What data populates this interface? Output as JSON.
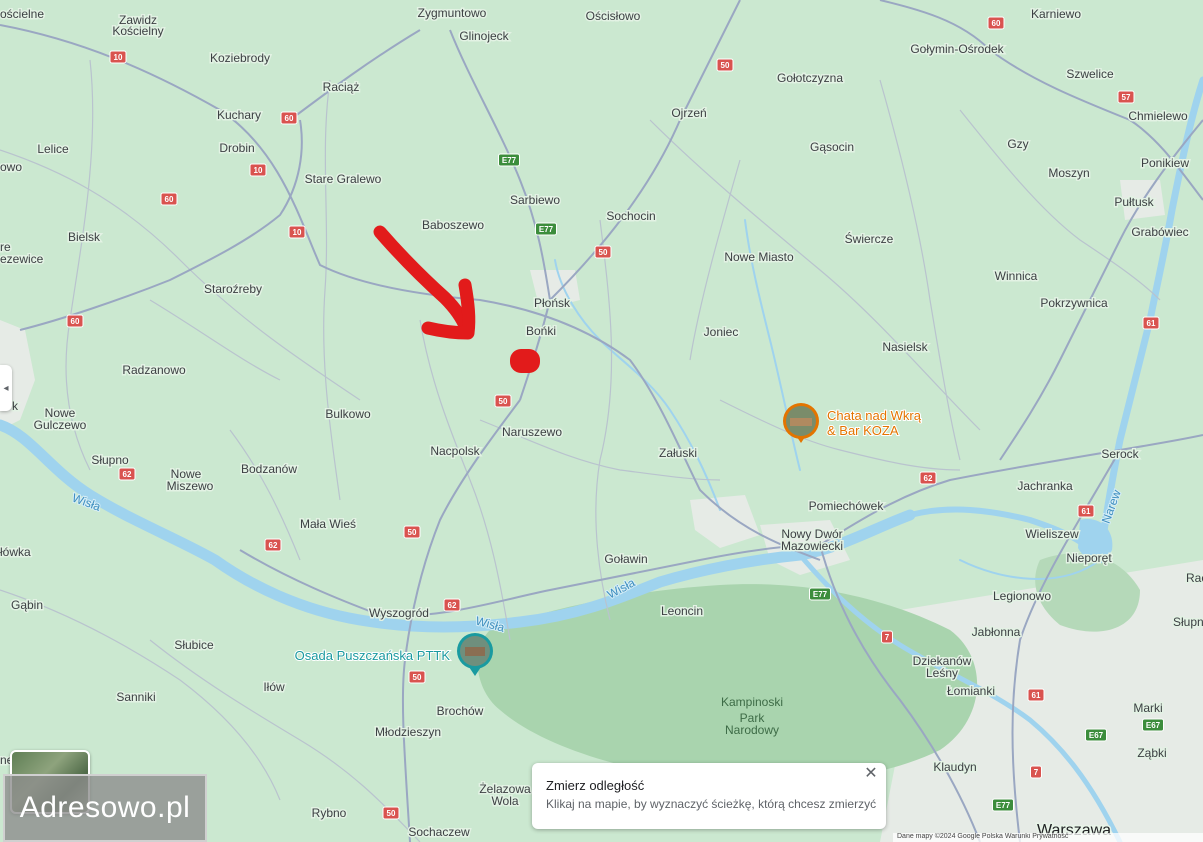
{
  "places": [
    {
      "id": "zygmuntowo",
      "name": "Zygmuntowo"
    },
    {
      "id": "oscislowo",
      "name": "Ościsłowo"
    },
    {
      "id": "karniewo",
      "name": "Karniewo"
    },
    {
      "id": "koscielne",
      "name": "ościelne"
    },
    {
      "id": "zawidz",
      "name": "Zawidz"
    },
    {
      "id": "zawidz2",
      "name": "Kościelny"
    },
    {
      "id": "glinojeck",
      "name": "Glinojeck"
    },
    {
      "id": "golymin",
      "name": "Gołymin-Ośrodek"
    },
    {
      "id": "koziebrody",
      "name": "Koziebrody"
    },
    {
      "id": "golotczyzna",
      "name": "Gołotczyzna"
    },
    {
      "id": "szwelice",
      "name": "Szwelice"
    },
    {
      "id": "raciaz",
      "name": "Raciąż"
    },
    {
      "id": "ojrzen",
      "name": "Ojrzeń"
    },
    {
      "id": "kuchary",
      "name": "Kuchary"
    },
    {
      "id": "chmielewo",
      "name": "Chmielewo"
    },
    {
      "id": "lelice",
      "name": "Lelice"
    },
    {
      "id": "drobin",
      "name": "Drobin"
    },
    {
      "id": "gasocin",
      "name": "Gąsocin"
    },
    {
      "id": "gzy",
      "name": "Gzy"
    },
    {
      "id": "ponikiew",
      "name": "Ponikiew"
    },
    {
      "id": "wo",
      "name": "owo"
    },
    {
      "id": "stare_gralewo",
      "name": "Stare Gralewo"
    },
    {
      "id": "moszyn",
      "name": "Moszyn"
    },
    {
      "id": "sarbiewo",
      "name": "Sarbiewo"
    },
    {
      "id": "pultusk",
      "name": "Pułtusk"
    },
    {
      "id": "baboszewo",
      "name": "Baboszewo"
    },
    {
      "id": "sochocin",
      "name": "Sochocin"
    },
    {
      "id": "bielsk",
      "name": "Bielsk"
    },
    {
      "id": "grabowiec",
      "name": "Grabówiec"
    },
    {
      "id": "swiercze",
      "name": "Świercze"
    },
    {
      "id": "ezewice",
      "name": "ezewice"
    },
    {
      "id": "re",
      "name": "re"
    },
    {
      "id": "nowe_miasto",
      "name": "Nowe Miasto"
    },
    {
      "id": "winnica",
      "name": "Winnica"
    },
    {
      "id": "starozreby",
      "name": "Staroźreby"
    },
    {
      "id": "plonsk",
      "name": "Płońsk"
    },
    {
      "id": "pokrzywnica",
      "name": "Pokrzywnica"
    },
    {
      "id": "bonki",
      "name": "Bońki"
    },
    {
      "id": "joniec",
      "name": "Joniec"
    },
    {
      "id": "nasielsk",
      "name": "Nasielsk"
    },
    {
      "id": "radzanowo",
      "name": "Radzanowo"
    },
    {
      "id": "k",
      "name": "k"
    },
    {
      "id": "nowe_gulczewo1",
      "name": "Nowe"
    },
    {
      "id": "nowe_gulczewo2",
      "name": "Gulczewo"
    },
    {
      "id": "bulkowo",
      "name": "Bulkowo"
    },
    {
      "id": "naruszewo",
      "name": "Naruszewo"
    },
    {
      "id": "serock",
      "name": "Serock"
    },
    {
      "id": "nacpolsk",
      "name": "Nacpolsk"
    },
    {
      "id": "zaluski",
      "name": "Załuski"
    },
    {
      "id": "slupno",
      "name": "Słupno"
    },
    {
      "id": "nowe_miszewo1",
      "name": "Nowe"
    },
    {
      "id": "nowe_miszewo2",
      "name": "Miszewo"
    },
    {
      "id": "bodzanow",
      "name": "Bodzanów"
    },
    {
      "id": "jachranka",
      "name": "Jachranka"
    },
    {
      "id": "pomiechowek",
      "name": "Pomiechówek"
    },
    {
      "id": "mala_wies",
      "name": "Mała Wieś"
    },
    {
      "id": "wieliszew",
      "name": "Wieliszew"
    },
    {
      "id": "nowy_dwor1",
      "name": "Nowy Dwór"
    },
    {
      "id": "nowy_dwor2",
      "name": "Mazowiecki"
    },
    {
      "id": "lowka",
      "name": "łówka"
    },
    {
      "id": "golawin",
      "name": "Goławin"
    },
    {
      "id": "nieporet",
      "name": "Nieporęt"
    },
    {
      "id": "rac",
      "name": "Rac"
    },
    {
      "id": "gabin",
      "name": "Gąbin"
    },
    {
      "id": "wyszogrod",
      "name": "Wyszogród"
    },
    {
      "id": "leoncin",
      "name": "Leoncin"
    },
    {
      "id": "legionowo",
      "name": "Legionowo"
    },
    {
      "id": "slubice",
      "name": "Słubice"
    },
    {
      "id": "slupn",
      "name": "Słupn"
    },
    {
      "id": "jablonna",
      "name": "Jabłonna"
    },
    {
      "id": "dziekanow1",
      "name": "Dziekanów"
    },
    {
      "id": "dziekanow2",
      "name": "Leśny"
    },
    {
      "id": "ilow",
      "name": "Iłów"
    },
    {
      "id": "sanniki",
      "name": "Sanniki"
    },
    {
      "id": "lomianki",
      "name": "Łomianki"
    },
    {
      "id": "brochow",
      "name": "Brochów"
    },
    {
      "id": "marki",
      "name": "Marki"
    },
    {
      "id": "mlodzieszyn",
      "name": "Młodzieszyn"
    },
    {
      "id": "zabki",
      "name": "Ząbki"
    },
    {
      "id": "klaudyn",
      "name": "Klaudyn"
    },
    {
      "id": "zelazowa1",
      "name": "Żelazowa"
    },
    {
      "id": "zelazowa2",
      "name": "Wola"
    },
    {
      "id": "rybno",
      "name": "Rybno"
    },
    {
      "id": "sochaczew",
      "name": "Sochaczew"
    },
    {
      "id": "ne",
      "name": "ne"
    }
  ],
  "big_places": [
    {
      "id": "warszawa",
      "name": "Warszawa"
    }
  ],
  "water_labels": [
    {
      "id": "wisla1",
      "name": "Wisła"
    },
    {
      "id": "wisla2",
      "name": "Wisła"
    },
    {
      "id": "wisla3",
      "name": "Wisła"
    },
    {
      "id": "narew",
      "name": "Narew"
    }
  ],
  "park": {
    "line1": "Kampinoski",
    "line2": "Park",
    "line3": "Narodowy"
  },
  "road_shields": [
    {
      "id": "s1",
      "label": "10",
      "color": "#d9534f"
    },
    {
      "id": "s2",
      "label": "60",
      "color": "#d9534f"
    },
    {
      "id": "s3",
      "label": "10",
      "color": "#d9534f"
    },
    {
      "id": "s4",
      "label": "60",
      "color": "#d9534f"
    },
    {
      "id": "s5",
      "label": "10",
      "color": "#d9534f"
    },
    {
      "id": "s6",
      "label": "60",
      "color": "#d9534f"
    },
    {
      "id": "s7",
      "label": "50",
      "color": "#d9534f"
    },
    {
      "id": "s8",
      "label": "50",
      "color": "#d9534f"
    },
    {
      "id": "s9",
      "label": "50",
      "color": "#d9534f"
    },
    {
      "id": "s10",
      "label": "50",
      "color": "#d9534f"
    },
    {
      "id": "s11",
      "label": "62",
      "color": "#d9534f"
    },
    {
      "id": "s12",
      "label": "62",
      "color": "#d9534f"
    },
    {
      "id": "s13",
      "label": "62",
      "color": "#d9534f"
    },
    {
      "id": "s14",
      "label": "62",
      "color": "#d9534f"
    },
    {
      "id": "s15",
      "label": "60",
      "color": "#d9534f"
    },
    {
      "id": "s16",
      "label": "57",
      "color": "#d9534f"
    },
    {
      "id": "s17",
      "label": "61",
      "color": "#d9534f"
    },
    {
      "id": "s18",
      "label": "61",
      "color": "#d9534f"
    },
    {
      "id": "s19",
      "label": "61",
      "color": "#d9534f"
    },
    {
      "id": "s20",
      "label": "7",
      "color": "#d9534f"
    },
    {
      "id": "s21",
      "label": "7",
      "color": "#d9534f"
    },
    {
      "id": "s22",
      "label": "50",
      "color": "#d9534f"
    },
    {
      "id": "s23",
      "label": "50",
      "color": "#d9534f"
    },
    {
      "id": "e1",
      "label": "E77",
      "color": "#3c8d3c"
    },
    {
      "id": "e2",
      "label": "E77",
      "color": "#3c8d3c"
    },
    {
      "id": "e3",
      "label": "E77",
      "color": "#3c8d3c"
    },
    {
      "id": "e4",
      "label": "E67",
      "color": "#3c8d3c"
    },
    {
      "id": "e5",
      "label": "E67",
      "color": "#3c8d3c"
    },
    {
      "id": "e6",
      "label": "E77",
      "color": "#3c8d3c"
    }
  ],
  "pois": [
    {
      "id": "chata",
      "line1": "Chata nad Wkrą",
      "line2": "& Bar KOZA",
      "color": "#e37400"
    },
    {
      "id": "osada",
      "line1": "Osada Puszczańska PTTK",
      "color": "#1a9aa0"
    }
  ],
  "annotation": {
    "color": "#e21b1b"
  },
  "measure": {
    "title": "Zmierz odległość",
    "description": "Klikaj na mapie, by wyznaczyć ścieżkę, którą chcesz zmierzyć",
    "close": "✕"
  },
  "watermark": "Adresowo.pl",
  "attribution": "Dane mapy ©2024 Google   Polska   Warunki   Prywatność",
  "collapse_icon": "◂"
}
